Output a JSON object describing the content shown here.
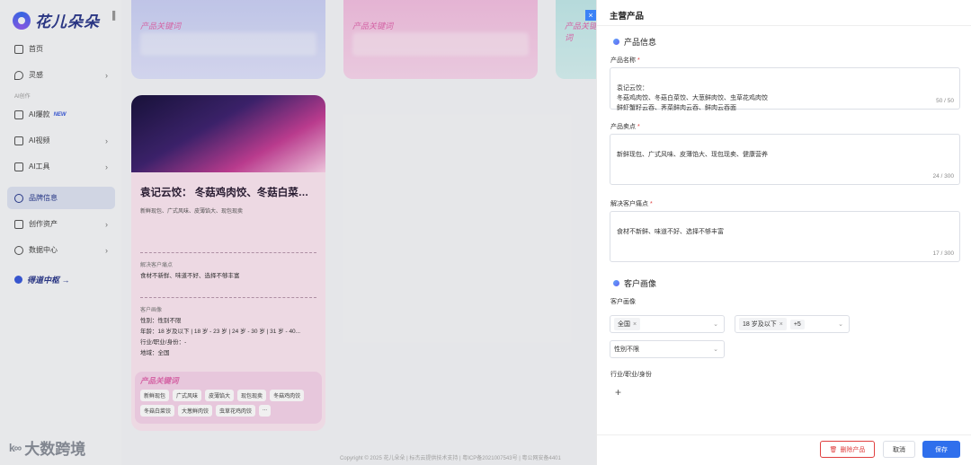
{
  "app": {
    "logo_text": "花儿朵朵"
  },
  "sidebar": {
    "items": [
      {
        "label": "首页",
        "icon": "home-icon"
      },
      {
        "label": "灵感",
        "icon": "location-icon"
      }
    ],
    "section_label": "AI创作",
    "ai_items": [
      {
        "label": "AI爆款",
        "badge": "NEW",
        "icon": "share-icon"
      },
      {
        "label": "AI视频",
        "icon": "video-add-icon"
      },
      {
        "label": "AI工具",
        "icon": "tool-add-icon"
      }
    ],
    "bottom_items": [
      {
        "label": "品牌信息",
        "icon": "brand-icon"
      },
      {
        "label": "创作资产",
        "icon": "folder-icon"
      },
      {
        "label": "数据中心",
        "icon": "chart-icon"
      }
    ],
    "brand_center": "得道中枢 →"
  },
  "main": {
    "top_card_keyword": "产品关键词",
    "card": {
      "title": "袁记云饺： 冬菇鸡肉饺、冬菇白菜饺...",
      "subtitle": "新鲜现包、广式风味、皮薄馅大、现包现卖",
      "pain_label": "解决客户痛点",
      "pain_text": "食材不新鲜、味道不好、选择不够丰富",
      "persona_label": "客户画像",
      "persona_lines": [
        "性别：性别不限",
        "年龄：18 岁及以下 | 18 岁 - 23 岁 | 24 岁 - 30 岁 | 31 岁 - 40...",
        "行业/职业/身份：-",
        "地域：全国"
      ],
      "keyword_title": "产品关键词",
      "keywords": [
        "新鲜现包",
        "广式风味",
        "皮薄馅大",
        "现包现卖",
        "冬菇鸡肉饺",
        "冬菇白菜饺",
        "大葱鲜肉饺",
        "虫草花鸡肉饺",
        "..."
      ]
    },
    "copyright": "Copyright © 2025 花儿朵朵 | 标杰云提供技术支持 | 粤ICP备2021007543号 | 粤公网安备4401"
  },
  "drawer": {
    "title": "主营产品",
    "section_product": "产品信息",
    "product_name_label": "产品名称",
    "product_name_value": "袁记云饺：\n冬菇鸡肉饺、冬菇白菜饺、大葱鲜肉饺、虫草花鸡肉饺\n鲜虾蟹籽云吞、荠菜鲜肉云吞、鲜肉云吞面",
    "product_name_count": "50 / 50",
    "selling_label": "产品卖点",
    "selling_value": "新鲜现包、广式风味、皮薄馅大、现包现卖、健康营养",
    "selling_count": "24 / 300",
    "pain_label": "解决客户痛点",
    "pain_value": "食材不新鲜、味道不好、选择不够丰富",
    "pain_count": "17 / 300",
    "section_persona": "客户画像",
    "persona_label": "客户画像",
    "region_tag": "全国",
    "age_tag": "18 岁及以下",
    "age_more": "+5",
    "gender_value": "性别不限",
    "industry_label": "行业/职业/身份",
    "add_symbol": "+",
    "buttons": {
      "delete": "删除产品",
      "cancel": "取消",
      "save": "保存"
    }
  },
  "watermark": {
    "logo": "k∞",
    "text": "大数跨境"
  },
  "colors": {
    "primary": "#2f6fec",
    "danger": "#e04040",
    "brand": "#2d3a8c",
    "keyword_pink": "#e26bb0"
  }
}
